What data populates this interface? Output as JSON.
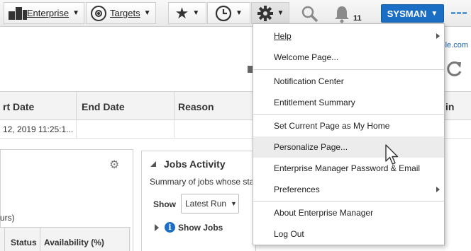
{
  "topbar": {
    "enterprise_label": "Enterprise",
    "targets_label": "Targets",
    "notification_count": "11",
    "user_label": "SYSMAN"
  },
  "background": {
    "link_fragment": "le.com",
    "table_headers": [
      "rt Date",
      "End Date",
      "Reason",
      "in"
    ],
    "table_row": [
      "12, 2019 11:25:1..."
    ],
    "jobs_title": "Jobs Activity",
    "jobs_summary": "Summary of jobs whose sta",
    "show_label": "Show",
    "show_select_value": "Latest Run",
    "show_jobs_label": "Show Jobs",
    "left_panel_fragment": "urs)",
    "status_header": "Status",
    "availability_header": "Availability (%)"
  },
  "menu": {
    "items": [
      {
        "label": "Help",
        "submenu": true
      },
      {
        "label": "Welcome Page...",
        "submenu": false
      },
      {
        "label": "Notification Center",
        "submenu": false
      },
      {
        "label": "Entitlement Summary",
        "submenu": false
      },
      {
        "label": "Set Current Page as My Home",
        "submenu": false
      },
      {
        "label": "Personalize Page...",
        "submenu": false
      },
      {
        "label": "Enterprise Manager Password & Email",
        "submenu": false
      },
      {
        "label": "Preferences",
        "submenu": true
      },
      {
        "label": "About Enterprise Manager",
        "submenu": false
      },
      {
        "label": "Log Out",
        "submenu": false
      }
    ],
    "highlighted": "Personalize Page..."
  },
  "colors": {
    "accent": "#1a6fc4",
    "menu_highlight": "#ececec",
    "link": "#1a5fb4"
  },
  "icons": [
    "enterprise-icon",
    "targets-icon",
    "star-icon",
    "clock-icon",
    "gear-icon",
    "search-icon",
    "bell-icon",
    "info-icon",
    "refresh-icon",
    "mouse-pointer-icon"
  ]
}
